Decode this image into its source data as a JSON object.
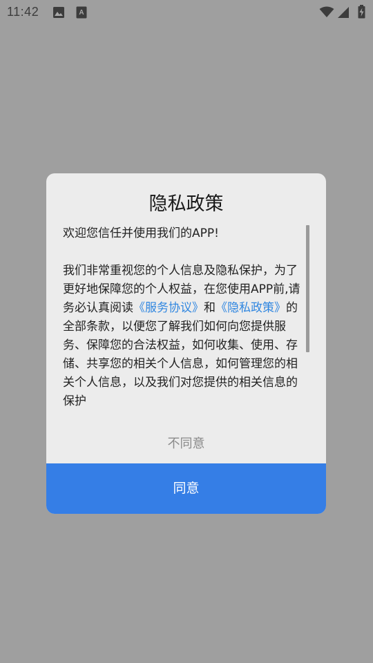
{
  "status_bar": {
    "time": "11:42",
    "icons": [
      "image-icon",
      "font-a-icon",
      "wifi-icon",
      "cellular-signal-icon",
      "battery-icon"
    ]
  },
  "dialog": {
    "title": "隐私政策",
    "intro": "欢迎您信任并使用我们的APP!",
    "body_prefix": " 我们非常重视您的个人信息及隐私保护，为了更好地保障您的个人权益，在您使用APP前,请务必认真阅读",
    "link_service": "《服务协议》",
    "body_and": "和",
    "link_privacy": "《隐私政策》",
    "body_suffix": "的全部条款，以便您了解我们如何向您提供服务、保障您的合法权益，如何收集、使用、存储、共享您的相关个人信息，如何管理您的相关个人信息，以及我们对您提供的相关信息的保护",
    "disagree_label": "不同意",
    "agree_label": "同意"
  },
  "colors": {
    "overlay": "#9f9f9f",
    "dialog_bg": "#ececec",
    "link": "#2f86e0",
    "agree_button": "#357ee6"
  }
}
